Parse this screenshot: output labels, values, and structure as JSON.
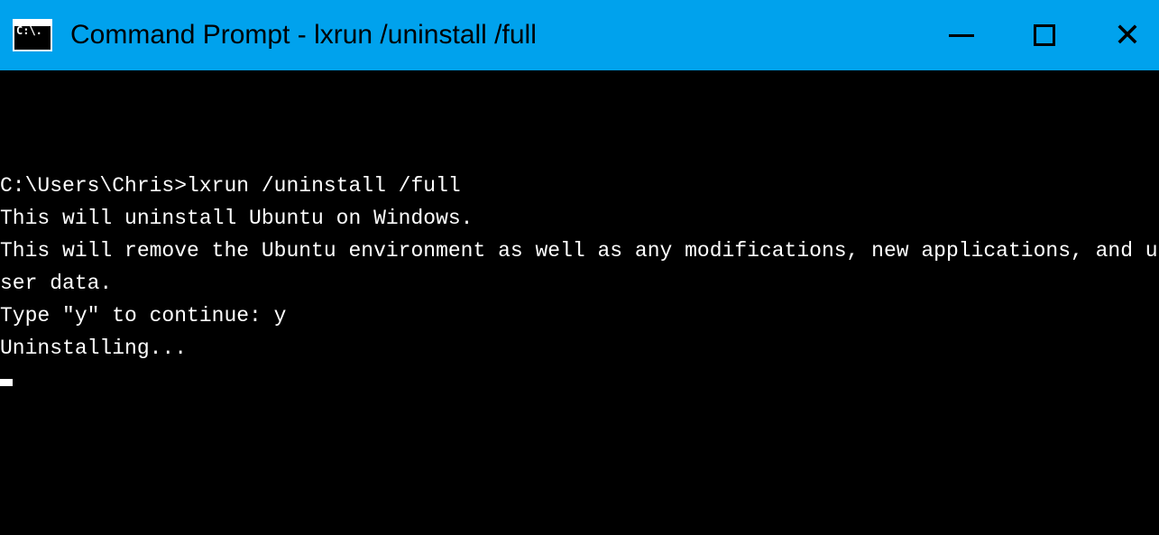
{
  "titlebar": {
    "icon_label": "C:\\.",
    "title": "Command Prompt - lxrun  /uninstall /full"
  },
  "terminal": {
    "prompt": "C:\\Users\\Chris>",
    "command": "lxrun /uninstall /full",
    "lines": [
      "This will uninstall Ubuntu on Windows.",
      "This will remove the Ubuntu environment as well as any modifications, new applications, and user data.",
      "Type \"y\" to continue: y",
      "Uninstalling..."
    ]
  }
}
